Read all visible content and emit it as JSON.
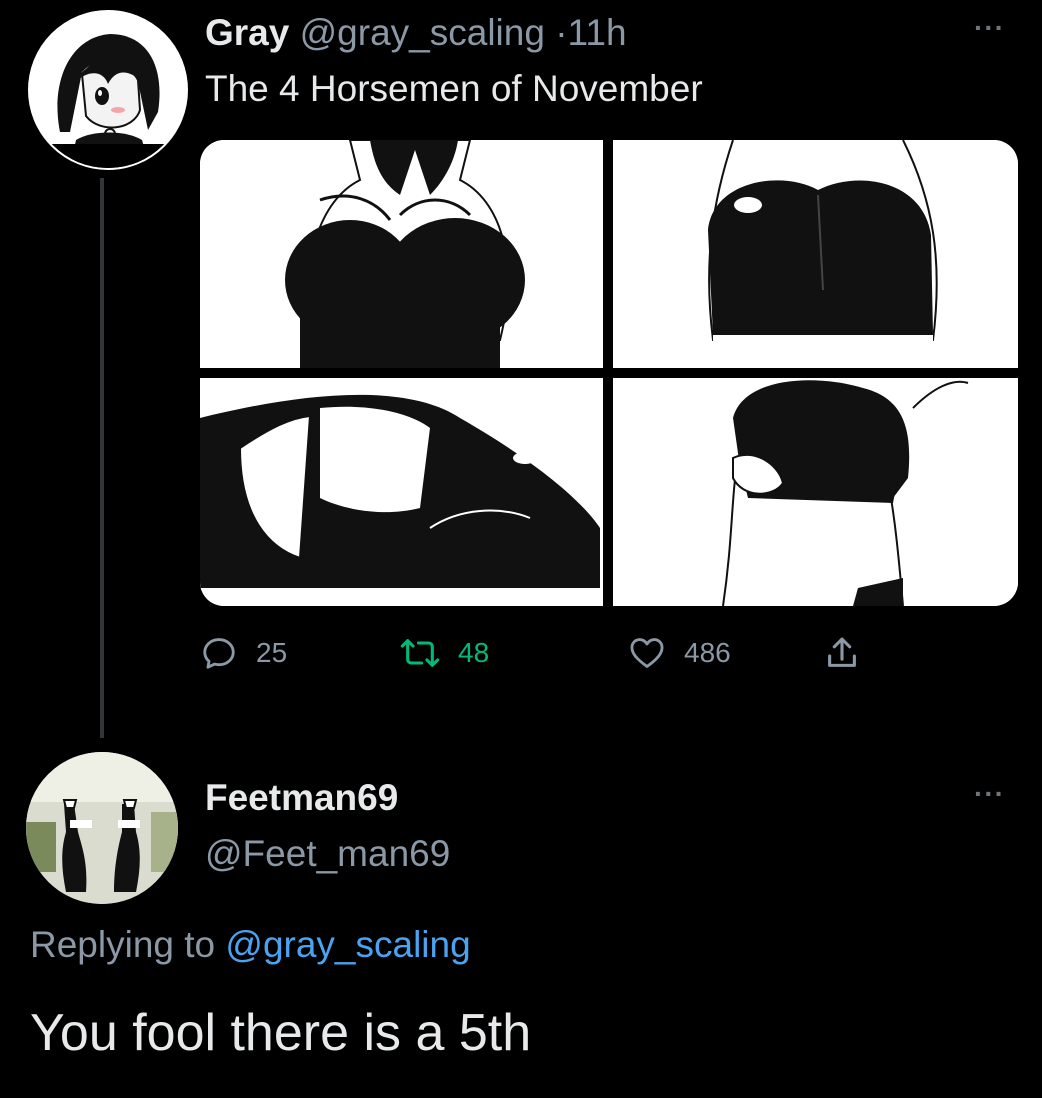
{
  "tweet": {
    "author": {
      "display_name": "Gray",
      "handle": "@gray_scaling",
      "avatar_icon": "anime-avatar-icon"
    },
    "separator": "·",
    "time": "11h",
    "text": "The 4 Horsemen of November",
    "media": [
      {
        "icon": "artwork-image-1"
      },
      {
        "icon": "artwork-image-2"
      },
      {
        "icon": "artwork-image-3"
      },
      {
        "icon": "artwork-image-4"
      }
    ],
    "actions": {
      "reply_count": "25",
      "retweet_count": "48",
      "like_count": "486"
    },
    "more": "···"
  },
  "reply": {
    "author": {
      "display_name": "Feetman69",
      "handle": "@Feet_man69",
      "avatar_icon": "shoes-photo-avatar-icon"
    },
    "replying_prefix": "Replying to",
    "replying_to": "@gray_scaling",
    "text": "You fool there is a 5th",
    "more": "···"
  },
  "colors": {
    "background": "#000000",
    "text": "#e7e9ea",
    "secondary": "#8b98a5",
    "retweet": "#00ba7c",
    "mention": "#4aa3f0"
  }
}
